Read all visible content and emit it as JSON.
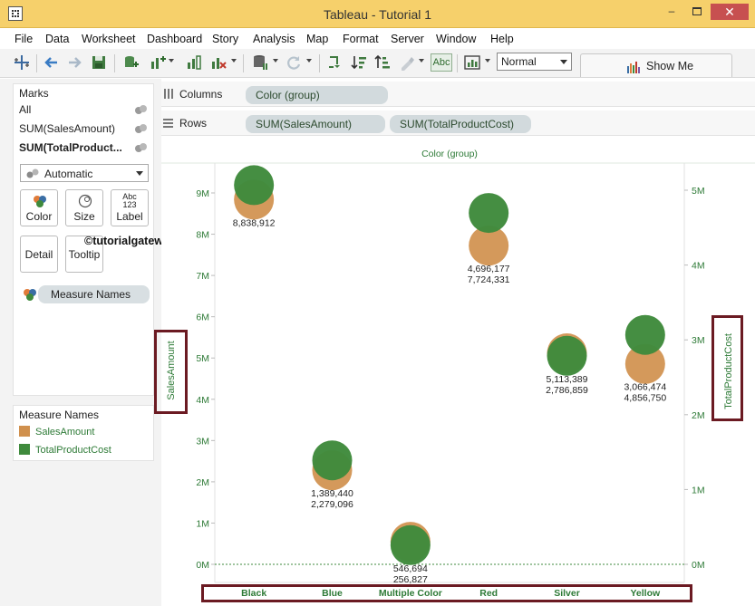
{
  "window": {
    "title": "Tableau - Tutorial 1",
    "min": "–",
    "close": "✕"
  },
  "menu": [
    "File",
    "Data",
    "Worksheet",
    "Dashboard",
    "Story",
    "Analysis",
    "Map",
    "Format",
    "Server",
    "Window",
    "Help"
  ],
  "toolbar": {
    "fit_select": "Normal",
    "show_me": "Show Me",
    "abc_label": "Abc"
  },
  "marks": {
    "header": "Marks",
    "rows": [
      "All",
      "SUM(SalesAmount)",
      "SUM(TotalProduct..."
    ],
    "mark_type": "Automatic",
    "cards": [
      "Color",
      "Size",
      "Label",
      "Detail",
      "Tooltip"
    ],
    "label_icon_text": "Abc\n123",
    "color_pill": "Measure Names"
  },
  "legend": {
    "header": "Measure Names",
    "items": [
      {
        "label": "SalesAmount",
        "color": "#d0904d"
      },
      {
        "label": "TotalProductCost",
        "color": "#3f8a3c"
      }
    ]
  },
  "shelves": {
    "columns_label": "Columns",
    "columns_pill": "Color (group)",
    "rows_label": "Rows",
    "rows_pills": [
      "SUM(SalesAmount)",
      "SUM(TotalProductCost)"
    ]
  },
  "watermark": "©tutorialgateway.org",
  "chart_data": {
    "type": "scatter",
    "title": "Color (group)",
    "xlabel": "",
    "categories": [
      "Black",
      "Blue",
      "Multiple Color",
      "Red",
      "Silver",
      "Yellow"
    ],
    "left_axis": {
      "label": "SalesAmount",
      "ticks": [
        "9M",
        "8M",
        "7M",
        "6M",
        "5M",
        "4M",
        "3M",
        "2M",
        "1M",
        "0M"
      ],
      "ylim": [
        0,
        9900000
      ]
    },
    "right_axis": {
      "label": "TotalProductCost",
      "ticks": [
        "5M",
        "4M",
        "3M",
        "2M",
        "1M",
        "0M"
      ],
      "ylim": [
        0,
        5460000
      ]
    },
    "series": [
      {
        "name": "SalesAmount",
        "axis": "left",
        "color": "#d0904d",
        "values": [
          8838912,
          2279096,
          546694,
          7724331,
          5113389,
          4856750
        ]
      },
      {
        "name": "TotalProductCost",
        "axis": "right",
        "color": "#3f8a3c",
        "values": [
          5067312,
          1389440,
          256827,
          4696177,
          2786859,
          3066474
        ]
      }
    ],
    "data_labels": [
      {
        "lines": [
          "8,838,912"
        ]
      },
      {
        "lines": [
          "1,389,440",
          "2,279,096"
        ]
      },
      {
        "lines": [
          "546,694",
          "256,827"
        ]
      },
      {
        "lines": [
          "4,696,177",
          "7,724,331"
        ]
      },
      {
        "lines": [
          "5,113,389",
          "2,786,859"
        ]
      },
      {
        "lines": [
          "3,066,474",
          "4,856,750"
        ]
      }
    ]
  }
}
